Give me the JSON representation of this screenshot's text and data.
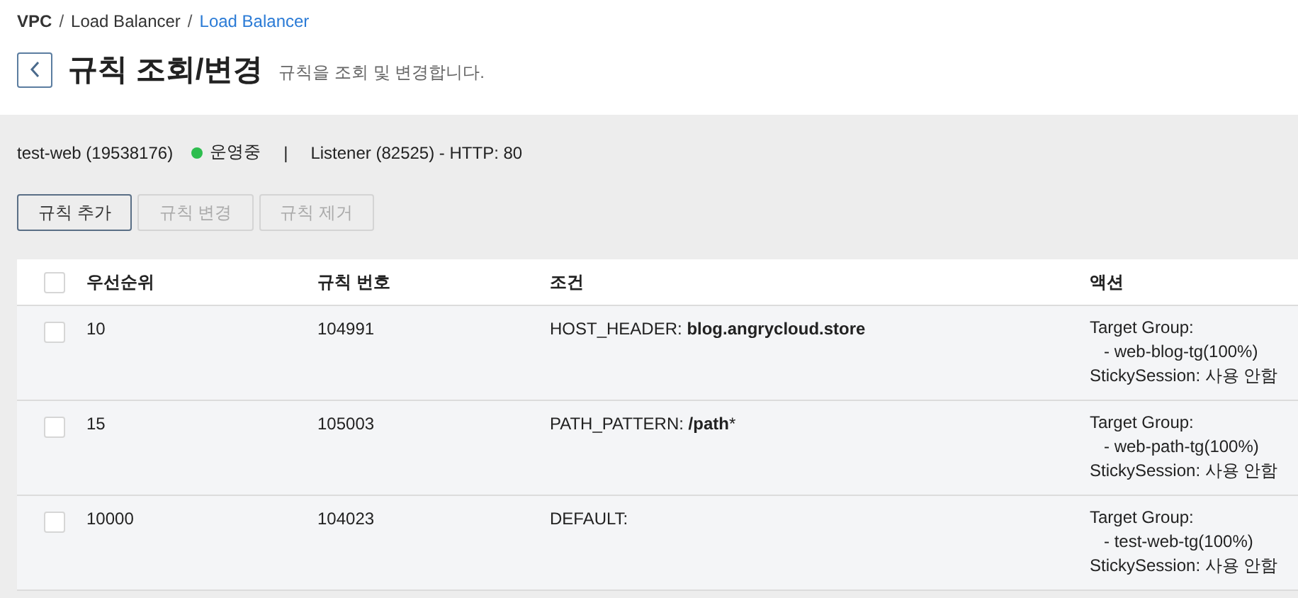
{
  "breadcrumb": {
    "separator": "/",
    "items": [
      {
        "label": "VPC",
        "kind": "root"
      },
      {
        "label": "Load Balancer",
        "kind": "link"
      },
      {
        "label": "Load Balancer",
        "kind": "current"
      }
    ]
  },
  "header": {
    "title": "규칙 조회/변경",
    "subtitle": "규칙을 조회 및 변경합니다."
  },
  "summary": {
    "name": "test-web (19538176)",
    "status": {
      "label": "운영중",
      "color": "#2dbd4e"
    },
    "divider": "|",
    "listener": "Listener (82525) - HTTP: 80"
  },
  "buttons": [
    {
      "label": "규칙 추가",
      "disabled": false
    },
    {
      "label": "규칙 변경",
      "disabled": true
    },
    {
      "label": "규칙 제거",
      "disabled": true
    }
  ],
  "table": {
    "select_all": {
      "checked": false
    },
    "columns": [
      "우선순위",
      "규칙 번호",
      "조건",
      "액션"
    ],
    "rows": [
      {
        "checked": false,
        "priority": "10",
        "rule_no": "104991",
        "condition": "HOST_HEADER: **blog.angrycloud.store**",
        "action": [
          "Target Group:",
          "- web-blog-tg(100%)",
          "StickySession: 사용 안함"
        ]
      },
      {
        "checked": false,
        "priority": "15",
        "rule_no": "105003",
        "condition": "PATH_PATTERN: **/path***",
        "action": [
          "Target Group:",
          "- web-path-tg(100%)",
          "StickySession: 사용 안함"
        ]
      },
      {
        "checked": false,
        "priority": "10000",
        "rule_no": "104023",
        "condition": "DEFAULT:",
        "action": [
          "Target Group:",
          "- test-web-tg(100%)",
          "StickySession: 사용 안함"
        ]
      }
    ]
  }
}
